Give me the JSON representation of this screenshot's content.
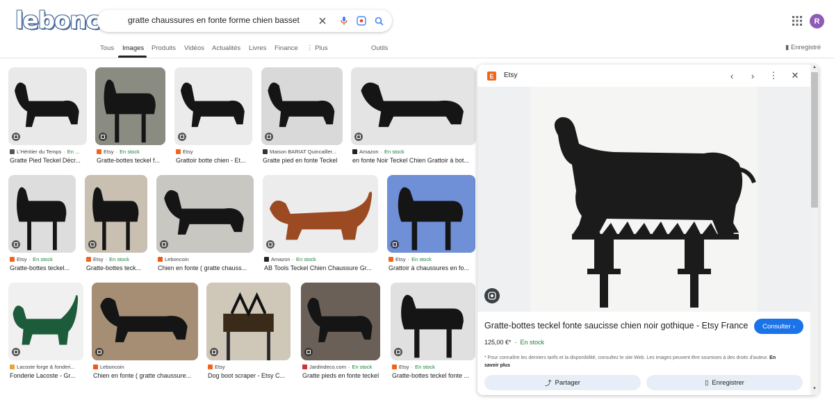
{
  "logo": {
    "text": "leboncoin"
  },
  "search": {
    "query": "gratte chaussures en fonte forme chien basset"
  },
  "tabs": [
    "Tous",
    "Images",
    "Produits",
    "Vidéos",
    "Actualités",
    "Livres",
    "Finance",
    "Plus",
    "Outils"
  ],
  "header": {
    "saved_label": "Enregistré",
    "avatar_letter": "R"
  },
  "colors": {
    "accent": "#1a73e8",
    "in_stock": "#188038",
    "etsy": "#f1641e"
  },
  "results": [
    {
      "source": "L'Héritier du Temps",
      "stock": "En ...",
      "title": "Gratte Pied Teckel Décr..."
    },
    {
      "source": "Etsy",
      "stock": "En stock",
      "title": "Gratte-bottes teckel f..."
    },
    {
      "source": "Etsy",
      "stock": "",
      "title": "Grattoir botte chien - Et..."
    },
    {
      "source": "Maison BARIAT Quincailler...",
      "stock": "",
      "title": "Gratte pied en fonte Teckel"
    },
    {
      "source": "Amazon",
      "stock": "En stock",
      "title": "en fonte Noir Teckel Chien Grattoir à bot..."
    },
    {
      "source": "Etsy",
      "stock": "En stock",
      "title": "Gratte-bottes teckel..."
    },
    {
      "source": "Etsy",
      "stock": "En stock",
      "title": "Gratte-bottes teck..."
    },
    {
      "source": "Leboncoin",
      "stock": "",
      "title": "Chien en fonte ( gratte chauss..."
    },
    {
      "source": "Amazon",
      "stock": "En stock",
      "title": "AB Tools Teckel Chien Chaussure Gr..."
    },
    {
      "source": "Etsy",
      "stock": "En stock",
      "title": "Grattoir à chaussures en fo..."
    },
    {
      "source": "Lacoste forge & fonderi...",
      "stock": "",
      "title": "Fonderie Lacoste - Gr..."
    },
    {
      "source": "Leboncoin",
      "stock": "",
      "title": "Chien en fonte ( gratte chaussure..."
    },
    {
      "source": "Etsy",
      "stock": "",
      "title": "Dog boot scraper - Etsy C..."
    },
    {
      "source": "Jardindeco.com",
      "stock": "En stock",
      "title": "Gratte pieds en fonte teckel"
    },
    {
      "source": "Etsy",
      "stock": "En stock",
      "title": "Gratte-bottes teckel fonte ..."
    }
  ],
  "panel": {
    "site": "Etsy",
    "title": "Gratte-bottes teckel fonte saucisse chien noir gothique - Etsy France",
    "visit_label": "Consulter",
    "price": "125,00 €*",
    "stock": "En stock",
    "note": "* Pour connaître les derniers tarifs et la disponibilité, consultez le site Web. Les images peuvent être soumises à des droits d'auteur.",
    "learn_more": "En savoir plus",
    "share_label": "Partager",
    "save_label": "Enregistrer"
  }
}
